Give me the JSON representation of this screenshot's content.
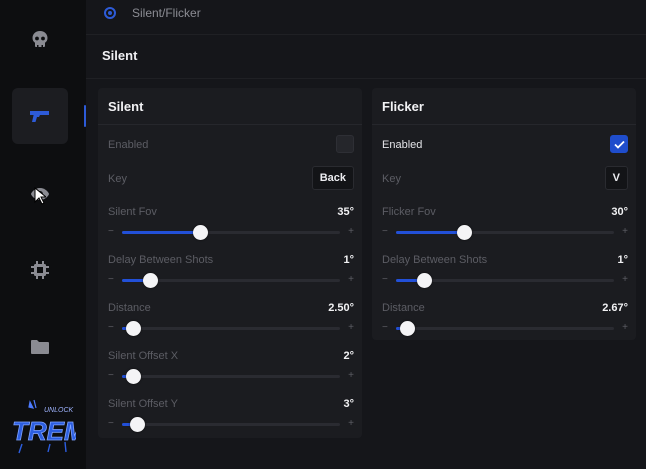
{
  "breadcrumb": {
    "label": "Silent/Flicker"
  },
  "section_title": "Silent",
  "sidebar": {
    "items": [
      {
        "icon": "skull-icon"
      },
      {
        "icon": "gun-icon",
        "active": true
      },
      {
        "icon": "eye-icon"
      },
      {
        "icon": "chip-icon"
      },
      {
        "icon": "folder-icon"
      }
    ],
    "logo_text": "TREM",
    "logo_sub": "UNLOCK"
  },
  "silent_panel": {
    "title": "Silent",
    "enabled_label": "Enabled",
    "enabled": false,
    "key_label": "Key",
    "key_value": "Back",
    "sliders": [
      {
        "label": "Silent Fov",
        "value": "35°",
        "fraction": 0.36
      },
      {
        "label": "Delay Between Shots",
        "value": "1°",
        "fraction": 0.13
      },
      {
        "label": "Distance",
        "value": "2.50°",
        "fraction": 0.05
      },
      {
        "label": "Silent Offset X",
        "value": "2°",
        "fraction": 0.05
      },
      {
        "label": "Silent Offset Y",
        "value": "3°",
        "fraction": 0.07
      }
    ]
  },
  "flicker_panel": {
    "title": "Flicker",
    "enabled_label": "Enabled",
    "enabled": true,
    "key_label": "Key",
    "key_value": "V",
    "sliders": [
      {
        "label": "Flicker Fov",
        "value": "30°",
        "fraction": 0.31
      },
      {
        "label": "Delay Between Shots",
        "value": "1°",
        "fraction": 0.13
      },
      {
        "label": "Distance",
        "value": "2.67°",
        "fraction": 0.05
      }
    ]
  },
  "slider_minus": "−",
  "slider_plus": "+"
}
